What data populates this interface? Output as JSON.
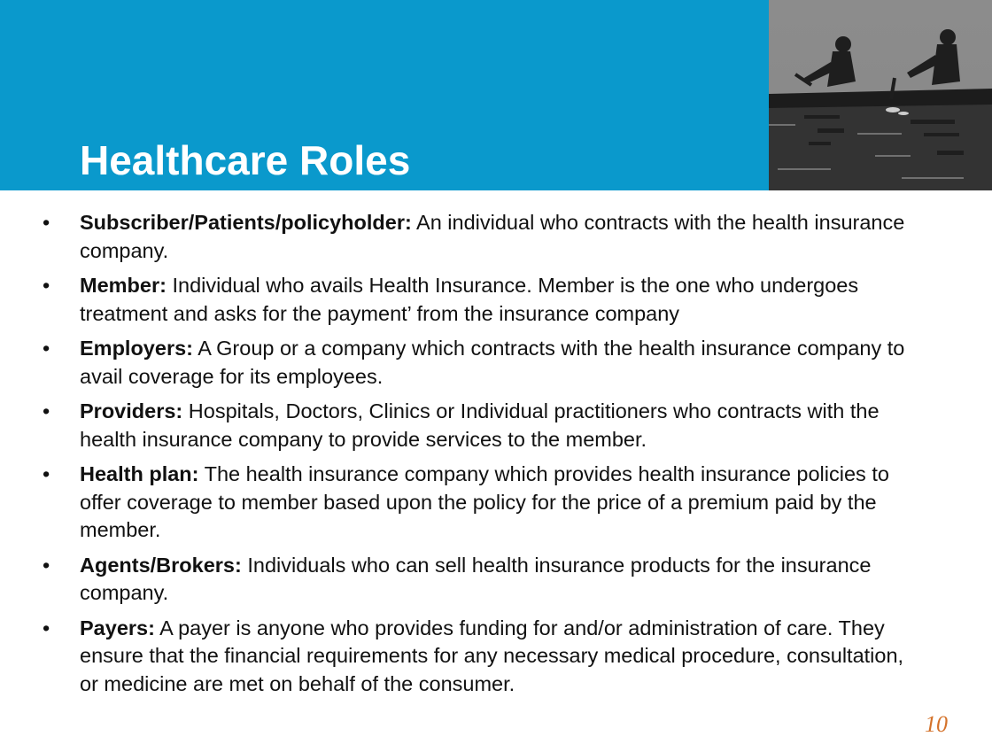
{
  "slide": {
    "title": "Healthcare Roles",
    "page_number": "10",
    "bullet_glyph": "•",
    "header_color": "#0a99cc",
    "page_number_color": "#d4722a",
    "photo_icon": "rowers-photo"
  },
  "bullets": [
    {
      "term": "Subscriber/Patients/policyholder:",
      "text": " An individual who contracts with the health insurance company."
    },
    {
      "term": "Member:",
      "text": " Individual who avails Health Insurance. Member is the one who undergoes treatment and asks for the payment’ from the insurance company"
    },
    {
      "term": "Employers:",
      "text": " A Group or a company which contracts with the health insurance company to avail coverage for its employees."
    },
    {
      "term": "Providers:",
      "text": " Hospitals, Doctors, Clinics or Individual practitioners who contracts with the health insurance company to provide services to the member."
    },
    {
      "term": "Health plan:",
      "text": " The health insurance company which provides health insurance policies to offer coverage to member based upon the policy for the price of a premium paid by the member."
    },
    {
      "term": "Agents/Brokers:",
      "text": " Individuals who can sell health insurance products for the insurance company."
    },
    {
      "term": "Payers:",
      "text": " A payer is anyone who provides funding for and/or administration of care. They ensure that the financial requirements for any necessary medical procedure, consultation, or medicine are met on behalf of the consumer."
    }
  ]
}
